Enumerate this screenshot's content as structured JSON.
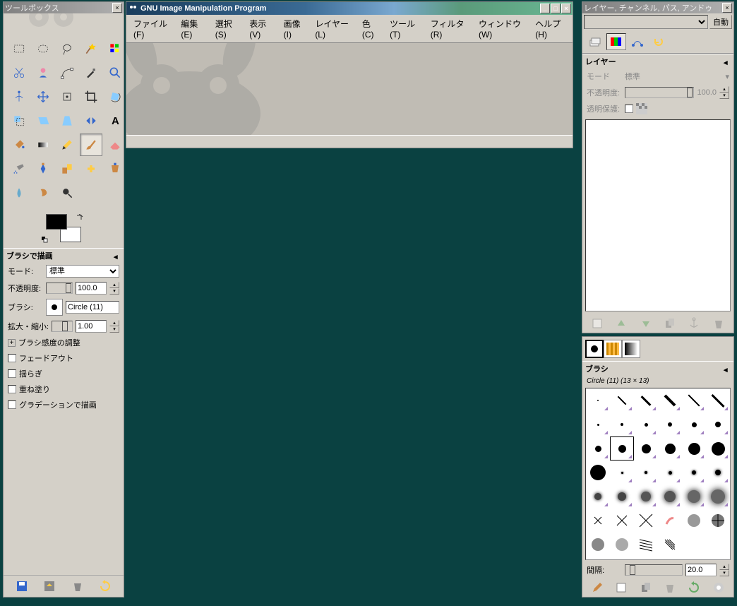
{
  "toolbox": {
    "title": "ツールボックス",
    "options_title": "ブラシで描画",
    "mode_label": "モード:",
    "mode_value": "標準",
    "opacity_label": "不透明度:",
    "opacity_value": "100.0",
    "brush_label": "ブラシ:",
    "brush_name": "Circle (11)",
    "scale_label": "拡大・縮小:",
    "scale_value": "1.00",
    "sensitivity": "ブラシ感度の調整",
    "fadeout": "フェードアウト",
    "jitter": "揺らぎ",
    "incremental": "重ね塗り",
    "gradient": "グラデーションで描画"
  },
  "main": {
    "title": "GNU Image Manipulation Program",
    "menu": {
      "file": "ファイル(F)",
      "edit": "編集(E)",
      "select": "選択(S)",
      "view": "表示(V)",
      "image": "画像(I)",
      "layer": "レイヤー(L)",
      "colors": "色(C)",
      "tools": "ツール(T)",
      "filters": "フィルタ(R)",
      "windows": "ウィンドウ(W)",
      "help": "ヘルプ(H)"
    }
  },
  "layers": {
    "title": "レイヤー, チャンネル, パス, アンドゥ",
    "auto": "自動",
    "section": "レイヤー",
    "mode_label": "モード",
    "mode_value": "標準",
    "opacity_label": "不透明度:",
    "opacity_value": "100.0",
    "lock_label": "透明保護:"
  },
  "brushes": {
    "section": "ブラシ",
    "current": "Circle (11) (13 × 13)",
    "spacing_label": "間隔:",
    "spacing_value": "20.0"
  }
}
